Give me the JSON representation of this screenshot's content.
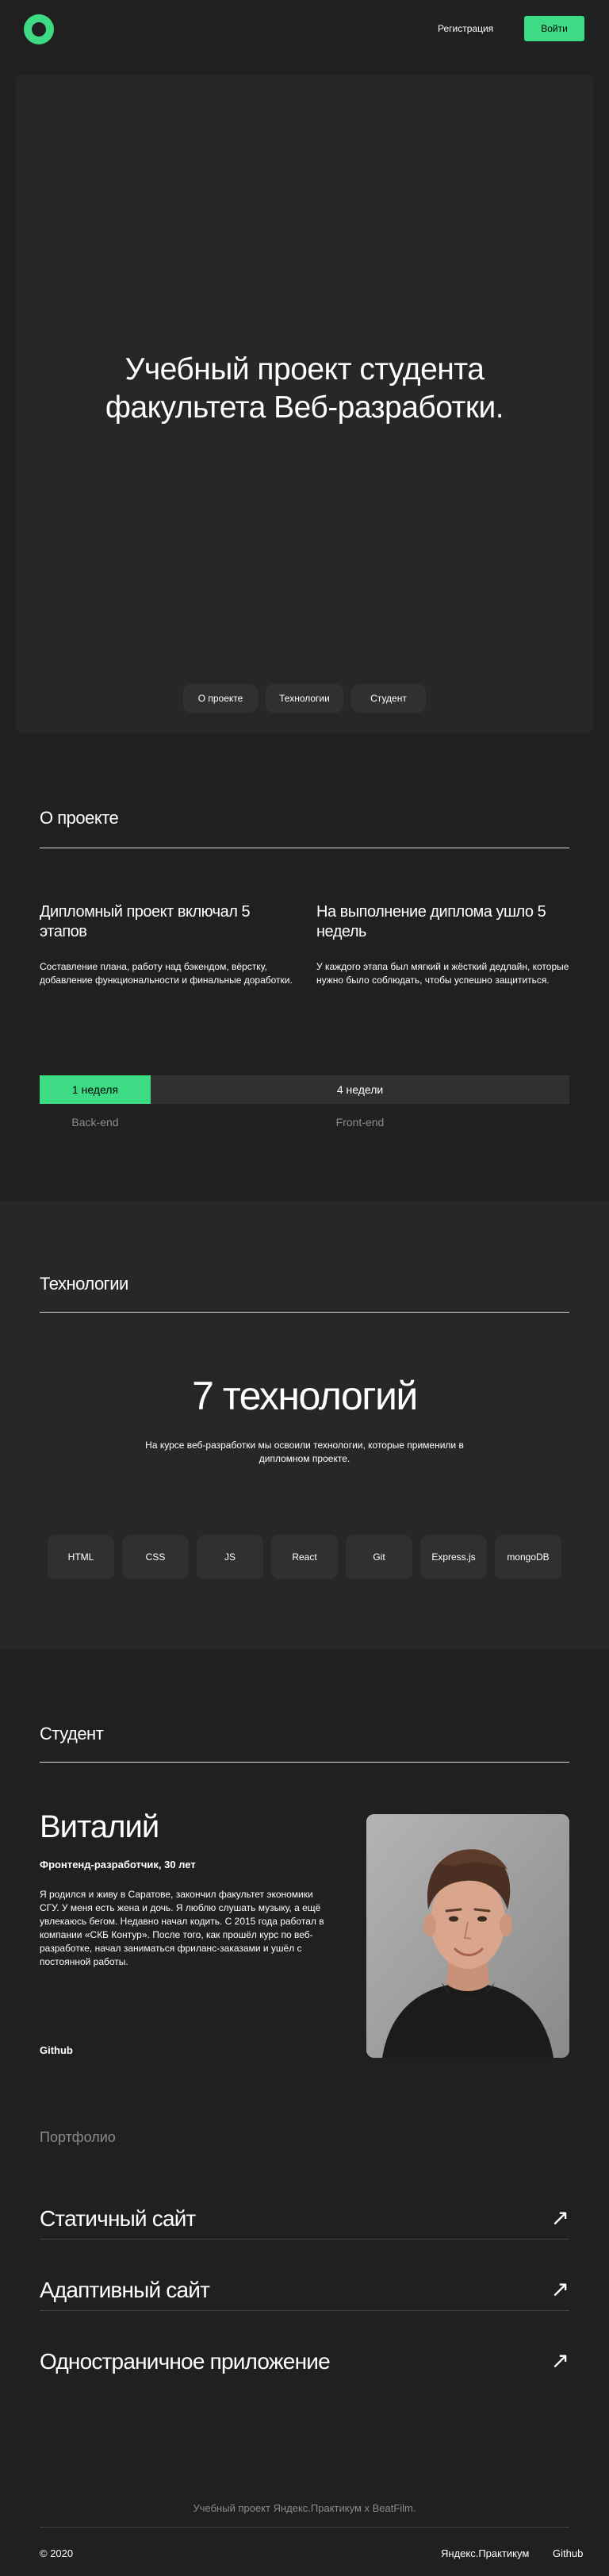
{
  "header": {
    "register_label": "Регистрация",
    "login_label": "Войти",
    "accent": "#3ddc84"
  },
  "hero": {
    "title_line1": "Учебный проект студента",
    "title_line2": "факультета Веб-разработки.",
    "nav": [
      "О проекте",
      "Технологии",
      "Студент"
    ]
  },
  "about": {
    "title": "О проекте",
    "col1_title": "Дипломный проект включал 5 этапов",
    "col1_text": "Составление плана, работу над бэкендом, вёрстку, добавление функциональности и финальные доработки.",
    "col2_title": "На выполнение диплома ушло 5 недель",
    "col2_text": "У каждого этапа был мягкий и жёсткий дедлайн, которые нужно было соблюдать, чтобы успешно защититься.",
    "bar_backend": "1 неделя",
    "bar_frontend": "4 недели",
    "cap_backend": "Back-end",
    "cap_frontend": "Front-end"
  },
  "tech": {
    "title": "Технологии",
    "headline": "7 технологий",
    "subtitle": "На курсе веб-разработки мы освоили технологии, которые применили в дипломном проекте.",
    "items": [
      "HTML",
      "CSS",
      "JS",
      "React",
      "Git",
      "Express.js",
      "mongoDB"
    ]
  },
  "student": {
    "title": "Студент",
    "name": "Виталий",
    "role": "Фронтенд-разработчик, 30 лет",
    "bio": "Я родился и живу в Саратове, закончил факультет экономики СГУ. У меня есть жена и дочь. Я люблю слушать музыку, а ещё увлекаюсь бегом. Недавно начал кодить. С 2015 года работал в компании «СКБ Контур». После того, как прошёл курс по веб-разработке, начал заниматься фриланс-заказами и ушёл с постоянной работы.",
    "github": "Github"
  },
  "portfolio": {
    "title": "Портфолио",
    "items": [
      "Статичный сайт",
      "Адаптивный сайт",
      "Одностраничное приложение"
    ],
    "arrow": "↗"
  },
  "footer": {
    "caption": "Учебный проект Яндекс.Практикум х BeatFilm.",
    "copyright": "© 2020",
    "link1": "Яндекс.Практикум",
    "link2": "Github"
  }
}
